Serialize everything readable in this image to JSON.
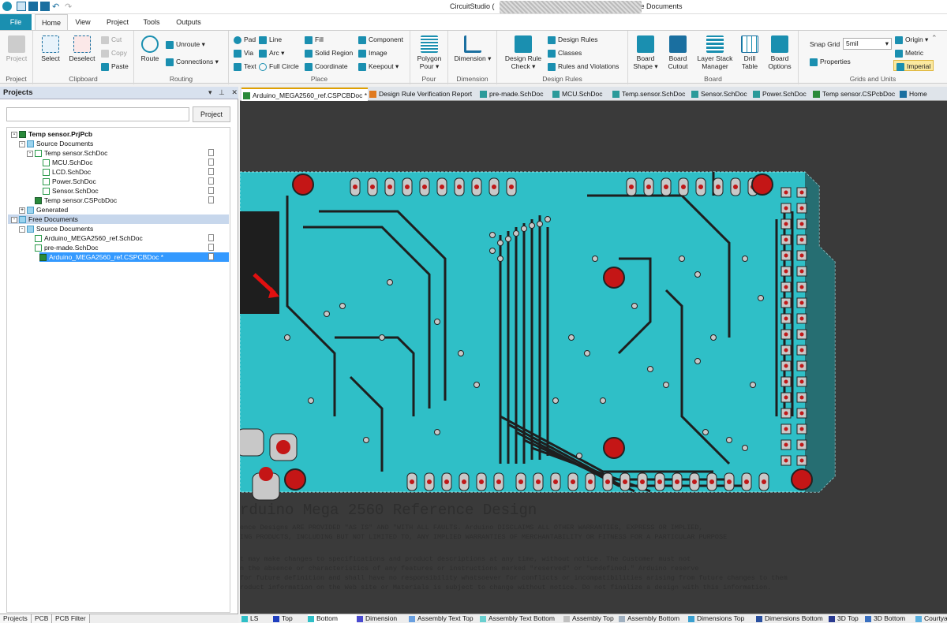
{
  "app": {
    "title_left": "CircuitStudio (",
    "title_right": "ee Documents"
  },
  "ribbon_tabs": [
    "File",
    "Home",
    "View",
    "Project",
    "Tools",
    "Outputs"
  ],
  "ribbon": {
    "project": {
      "label": "Project",
      "group": "Project"
    },
    "clipboard": {
      "select": "Select",
      "deselect": "Deselect",
      "cut": "Cut",
      "copy": "Copy",
      "paste": "Paste",
      "group": "Clipboard"
    },
    "routing": {
      "route": "Route",
      "unroute": "Unroute",
      "connections": "Connections",
      "group": "Routing"
    },
    "place": {
      "pad": "Pad",
      "via": "Via",
      "text": "Text",
      "line": "Line",
      "arc": "Arc",
      "full_circle": "Full Circle",
      "fill": "Fill",
      "solid_region": "Solid Region",
      "coordinate": "Coordinate",
      "component": "Component",
      "image": "Image",
      "keepout": "Keepout",
      "group": "Place"
    },
    "pour": {
      "label": "Polygon Pour",
      "group": "Pour"
    },
    "dimension": {
      "label": "Dimension",
      "group": "Dimension"
    },
    "design_rules": {
      "check": "Design Rule Check",
      "rules": "Design Rules",
      "classes": "Classes",
      "violations": "Rules and Violations",
      "group": "Design Rules"
    },
    "board": {
      "shape": "Board Shape",
      "cutout": "Board Cutout",
      "stack": "Layer Stack Manager",
      "drill": "Drill Table",
      "options": "Board Options",
      "group": "Board"
    },
    "grids": {
      "snap_label": "Snap Grid",
      "snap_value": "5mil",
      "properties": "Properties",
      "origin": "Origin",
      "metric": "Metric",
      "imperial": "Imperial",
      "group": "Grids and Units"
    }
  },
  "panel": {
    "title": "Projects",
    "project_button": "Project",
    "tree": [
      {
        "label": "Temp sensor.PrjPcb",
        "level": 0,
        "icon": "pcbproj",
        "bold": true,
        "exp": "-"
      },
      {
        "label": "Source Documents",
        "level": 1,
        "icon": "folder",
        "exp": "-"
      },
      {
        "label": "Temp sensor.SchDoc",
        "level": 2,
        "icon": "sch",
        "exp": "-",
        "doc": true
      },
      {
        "label": "MCU.SchDoc",
        "level": 3,
        "icon": "sch",
        "doc": true
      },
      {
        "label": "LCD.SchDoc",
        "level": 3,
        "icon": "sch",
        "doc": true
      },
      {
        "label": "Power.SchDoc",
        "level": 3,
        "icon": "sch",
        "doc": true
      },
      {
        "label": "Sensor.SchDoc",
        "level": 3,
        "icon": "sch",
        "doc": true
      },
      {
        "label": "Temp sensor.CSPcbDoc",
        "level": 2,
        "icon": "pcb",
        "doc": true
      },
      {
        "label": "Generated",
        "level": 1,
        "icon": "folder",
        "exp": "+"
      },
      {
        "label": "Free Documents",
        "level": 0,
        "icon": "folder",
        "exp": "-",
        "header": true
      },
      {
        "label": "Source Documents",
        "level": 1,
        "icon": "folder",
        "exp": "-"
      },
      {
        "label": "Arduino_MEGA2560_ref.SchDoc",
        "level": 2,
        "icon": "sch",
        "doc": true
      },
      {
        "label": "pre-made.SchDoc",
        "level": 2,
        "icon": "sch",
        "doc": true
      },
      {
        "label": "Arduino_MEGA2560_ref.CSPCBDoc *",
        "level": 2,
        "icon": "pcb",
        "doc": true,
        "selected": true
      }
    ]
  },
  "bottom_tabs": [
    "Projects",
    "PCB",
    "PCB Filter"
  ],
  "doc_tabs": [
    {
      "label": "Arduino_MEGA2560_ref.CSPCBDoc *",
      "icon": "pcb",
      "active": true
    },
    {
      "label": "Design Rule Verification Report",
      "icon": "report"
    },
    {
      "label": "pre-made.SchDoc",
      "icon": "sch"
    },
    {
      "label": "MCU.SchDoc",
      "icon": "sch"
    },
    {
      "label": "Temp.sensor.SchDoc",
      "icon": "sch"
    },
    {
      "label": "Sensor.SchDoc",
      "icon": "sch"
    },
    {
      "label": "Power.SchDoc",
      "icon": "sch"
    },
    {
      "label": "Temp sensor.CSPcbDoc",
      "icon": "pcb"
    },
    {
      "label": "Home",
      "icon": "home"
    }
  ],
  "canvas": {
    "heading": "rduino  Mega 2560 Reference Design",
    "line1": "ence Designs ARE PROVIDED \"AS IS\" AND \"WITH ALL FAULTS. Arduino DISCLAIMS ALL OTHER WARRANTIES, EXPRESS OR IMPLIED,",
    "line2": "ING PRODUCTS, INCLUDING BUT NOT LIMITED TO, ANY IMPLIED WARRANTIES OF MERCHANTABILITY OR FITNESS FOR A PARTICULAR PURPOSE",
    "line3": "t may make changes to specifications and product descriptions at any time, without notice. The Customer must not",
    "line4": "n the absence or characteristics of any features or instructions marked \"reserved\" or \"undefined.\" Arduino reserve",
    "line5": "for future definition and shall have no responsibility whatsoever for conflicts or incompatibilities arising from future changes to them",
    "line6": "roduct information on the Web site or Materials is subject to change without notice. Do not finalize a design with this information."
  },
  "layers": [
    {
      "label": "LS",
      "color": "#2fbfc7"
    },
    {
      "label": "Top",
      "color": "#1f3fbf"
    },
    {
      "label": "Bottom",
      "color": "#2fbfc7",
      "active": true
    },
    {
      "label": "Dimension",
      "color": "#4a4ad0"
    },
    {
      "label": "Assembly Text Top",
      "color": "#6aa0e0"
    },
    {
      "label": "Assembly Text Bottom",
      "color": "#6ad0d0"
    },
    {
      "label": "Assembly Top",
      "color": "#c0c0c0"
    },
    {
      "label": "Assembly Bottom",
      "color": "#a0b0c0"
    },
    {
      "label": "Dimensions Top",
      "color": "#3aa0d0"
    },
    {
      "label": "Dimensions Bottom",
      "color": "#2a50a0"
    },
    {
      "label": "3D Top",
      "color": "#2a3a90"
    },
    {
      "label": "3D Bottom",
      "color": "#3a70c0"
    },
    {
      "label": "Courtyard Top",
      "color": "#5ab0e0"
    }
  ],
  "colors": {
    "accent": "#1a8fb0",
    "board": "#2fbfc7",
    "copper": "#1e1e1e",
    "pad": "#c8c8c8",
    "hole": "#c01818"
  }
}
